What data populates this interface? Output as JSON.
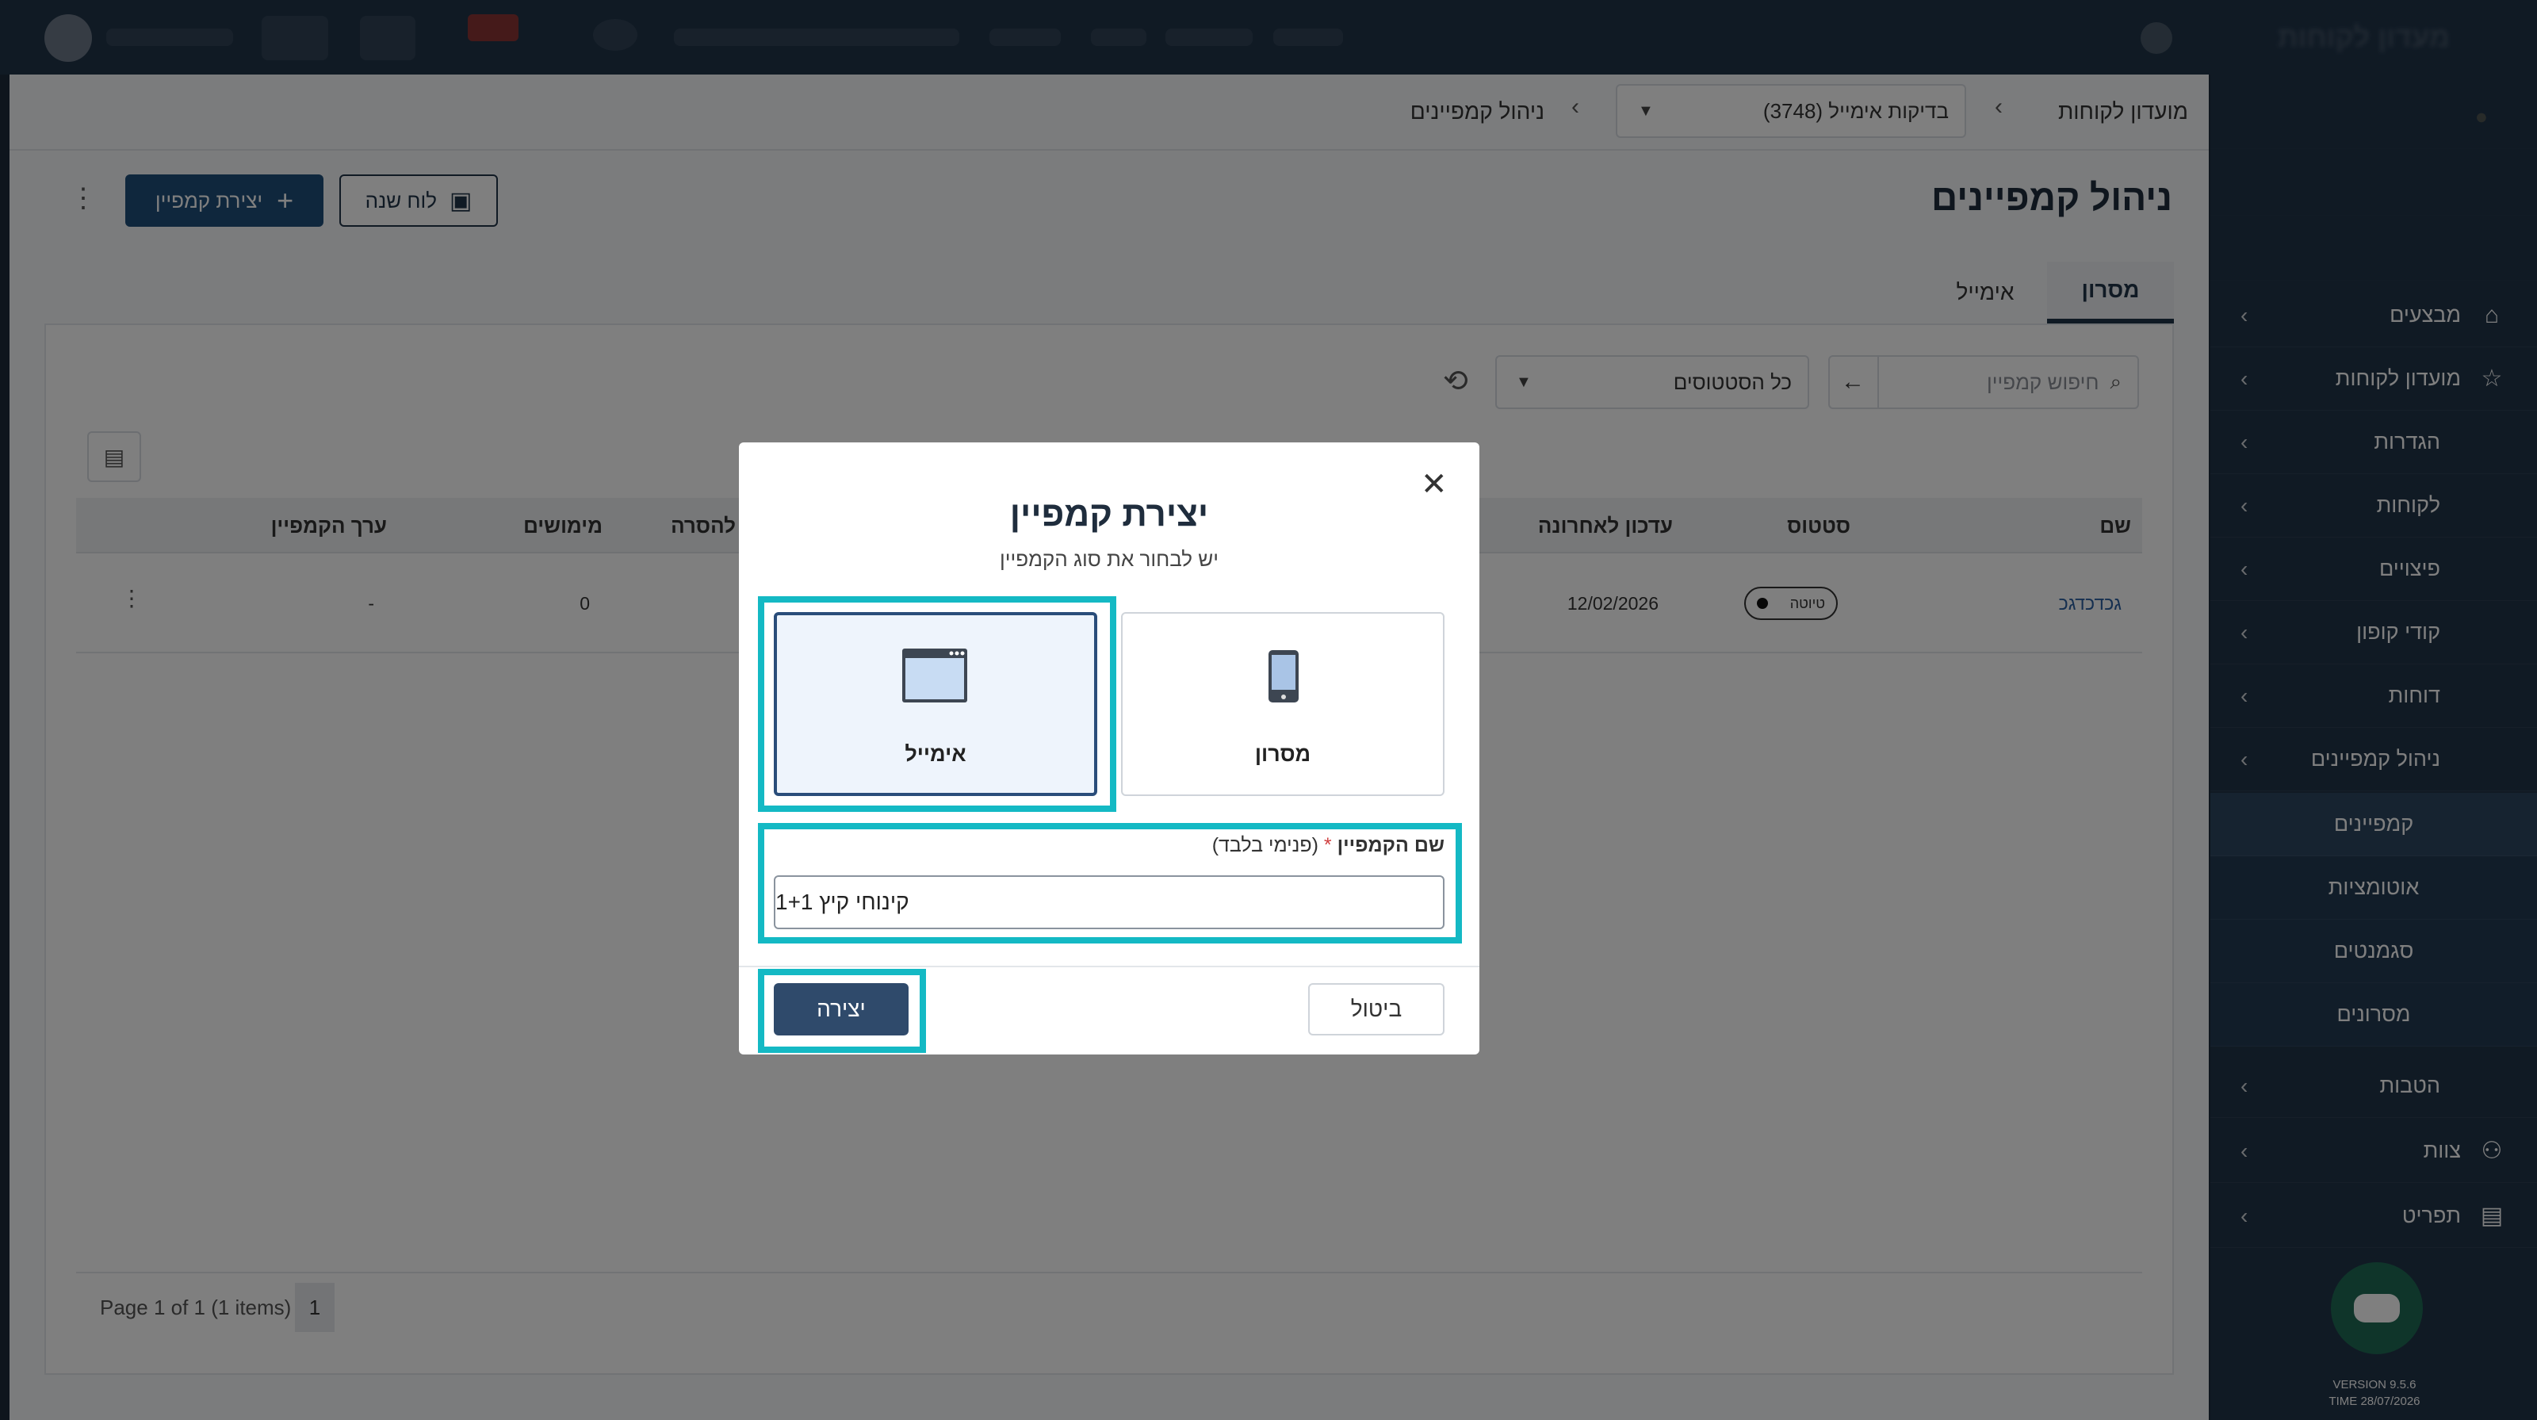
{
  "topbar": {
    "brand": "מעדון לקוחות"
  },
  "breadcrumb": {
    "root": "מועדון לקוחות",
    "selector_value": "(3748) בדיקות אימייל",
    "current": "ניהול קמפיינים"
  },
  "page": {
    "title": "ניהול קמפיינים",
    "year_board_label": "לוח שנה",
    "create_campaign_label": "יצירת קמפיין"
  },
  "tabs": [
    {
      "label": "מסרון",
      "active": true
    },
    {
      "label": "אימייל",
      "active": false
    }
  ],
  "filters": {
    "search_placeholder": "חיפוש קמפיין",
    "status_value": "כל הסטטוסים"
  },
  "table": {
    "headers": {
      "name": "שם",
      "status": "סטטוס",
      "last_updated": "עדכון לאחרונה",
      "removal": "להסרה",
      "redemptions": "מימושים",
      "campaign_value": "ערך הקמפיין"
    },
    "rows": [
      {
        "name": "גכדכדגכ",
        "status": "טיוטה",
        "last_updated": "12/02/2026",
        "redemptions": "0",
        "campaign_value": "-"
      }
    ]
  },
  "pager": {
    "text": "Page 1 of 1 (1 items)",
    "page": "1"
  },
  "sidebar": {
    "items": [
      {
        "label": "מבצעים",
        "icon": "tag-icon"
      },
      {
        "label": "מועדון לקוחות",
        "icon": "star-icon"
      },
      {
        "label": "הגדרות"
      },
      {
        "label": "לקוחות"
      },
      {
        "label": "פיצויים"
      },
      {
        "label": "קודי קופון"
      },
      {
        "label": "דוחות"
      },
      {
        "label": "ניהול קמפיינים"
      },
      {
        "label": "קמפיינים"
      },
      {
        "label": "אוטומציות"
      },
      {
        "label": "סגמנטים"
      },
      {
        "label": "מסרונים"
      },
      {
        "label": "הטבות"
      },
      {
        "label": "צוות",
        "icon": "team-icon"
      },
      {
        "label": "תפריט",
        "icon": "menu-icon"
      }
    ],
    "version": "VERSION 9.5.6",
    "time": "TIME 28/07/2026"
  },
  "modal": {
    "title": "יצירת קמפיין",
    "subtitle": "יש לבחור את סוג הקמפיין",
    "types": [
      {
        "label": "אימייל",
        "selected": true,
        "icon": "browser-window-icon"
      },
      {
        "label": "מסרון",
        "selected": false,
        "icon": "mobile-phone-icon"
      }
    ],
    "field_label": "שם הקמפיין",
    "field_required": "*",
    "field_hint": "(פנימי בלבד)",
    "field_value": "קינוחי קיץ 1+1",
    "create_label": "יצירה",
    "cancel_label": "ביטול"
  },
  "colors": {
    "sidebar_bg": "#203449",
    "primary": "#1e4f7a",
    "highlight": "#14b9c4",
    "selected_card_bg": "#eef4fc"
  }
}
